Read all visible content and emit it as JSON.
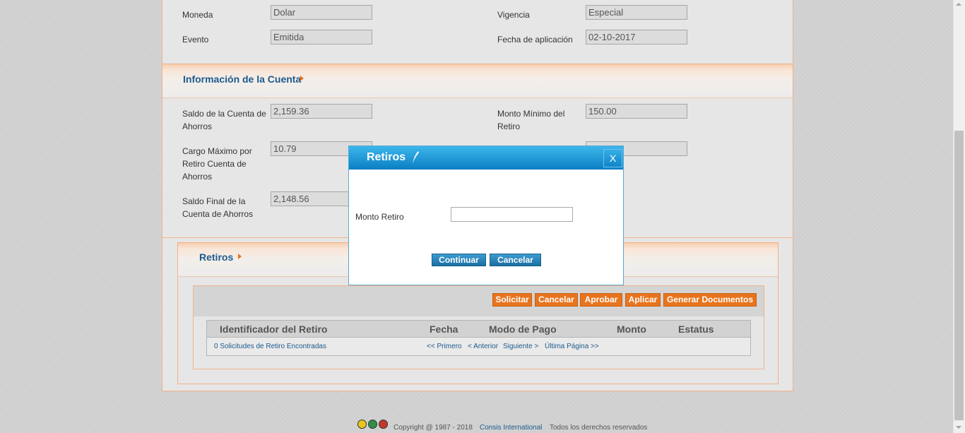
{
  "form": {
    "moneda_label": "Moneda",
    "moneda_value": "Dolar",
    "vigencia_label": "Vigencia",
    "vigencia_value": "Especial",
    "evento_label": "Evento",
    "evento_value": "Emitida",
    "fecha_aplicacion_label": "Fecha de aplicación",
    "fecha_aplicacion_value": "02-10-2017"
  },
  "cuenta": {
    "title": "Información de la Cuenta",
    "saldo_label": "Saldo de la Cuenta de Ahorros",
    "saldo_value": "2,159.36",
    "monto_minimo_label": "Monto Mínimo del Retiro",
    "monto_minimo_value": "150.00",
    "cargo_maximo_label": "Cargo Máximo por Retiro Cuenta de Ahorros",
    "cargo_maximo_value": "10.79",
    "saldo_final_label": "Saldo Final de la Cuenta de Ahorros",
    "saldo_final_value": "2,148.56"
  },
  "retiros": {
    "title": "Retiros",
    "buttons": {
      "solicitar": "Solicitar",
      "cancelar": "Cancelar",
      "aprobar": "Aprobar",
      "aplicar": "Aplicar",
      "generar": "Generar Documentos"
    },
    "columns": [
      "Identificador del Retiro",
      "Fecha",
      "Modo de Pago",
      "Monto",
      "Estatus"
    ],
    "found_text": "0 Solicitudes de Retiro Encontradas",
    "pager": {
      "first": "<< Primero",
      "prev": "< Anterior",
      "next": "Siguiente >",
      "last": "Última Página >>"
    }
  },
  "modal": {
    "title": "Retiros",
    "close": "X",
    "monto_label": "Monto Retiro",
    "monto_value": "",
    "continuar": "Continuar",
    "cancelar": "Cancelar"
  },
  "footer": {
    "copyright": "Copyright @ 1987 - 2018",
    "company": "Consis International",
    "rights": "Todos los derechos reservados"
  },
  "colors": {
    "accent_orange": "#e8741e",
    "link_blue": "#1d5a8c",
    "modal_blue": "#0a7fc4"
  }
}
